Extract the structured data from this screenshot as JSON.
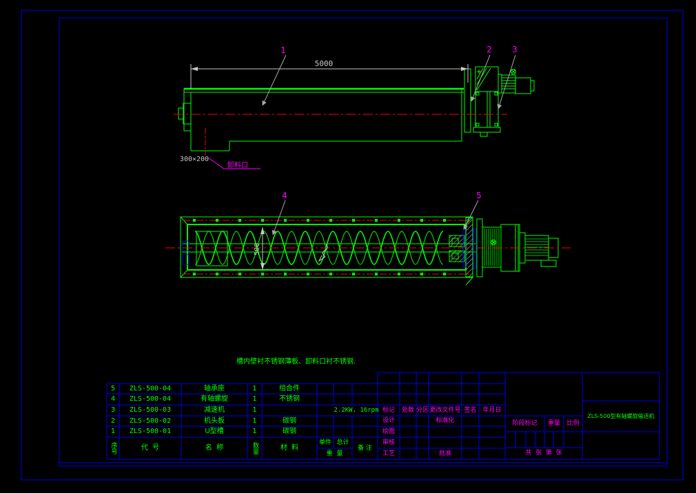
{
  "note": "槽内壁衬不锈钢薄板、卸料口衬不锈钢.",
  "top_view": {
    "dim_length": "5000",
    "chute_dim": "300×200",
    "chute_label": "卸料口",
    "balloon_1": "1",
    "balloon_2": "2",
    "balloon_3": "3"
  },
  "bottom_view": {
    "dim_width": "500",
    "balloon_4": "4",
    "balloon_5": "5"
  },
  "colors": {
    "line_green": "#00ff00",
    "line_red": "#ff0000",
    "line_blue": "#0000ee",
    "label_magenta": "#ff00ff",
    "dim_white": "#c8c8c8"
  },
  "parts_table": {
    "headers": {
      "seq": "序号",
      "code": "代  号",
      "name": "名  称",
      "qty": "数量",
      "material": "材  料",
      "unit_piece": "单件",
      "total": "总计",
      "weight": "重  量",
      "remark": "备 注"
    },
    "rows": [
      {
        "seq": "5",
        "code": "ZLS-500-04",
        "name": "轴承座",
        "qty": "1",
        "material": "组合件"
      },
      {
        "seq": "4",
        "code": "ZLS-500-04",
        "name": "有轴螺旋",
        "qty": "1",
        "material": "不锈钢"
      },
      {
        "seq": "3",
        "code": "ZLS-500-03",
        "name": "减速机",
        "qty": "1",
        "material": "",
        "remark": "2.2KW, 16rpm"
      },
      {
        "seq": "2",
        "code": "ZLS-500-02",
        "name": "机头板",
        "qty": "1",
        "material": "碳钢"
      },
      {
        "seq": "1",
        "code": "ZLS-500-01",
        "name": "U型槽",
        "qty": "1",
        "material": "碳钢"
      }
    ]
  },
  "title_block": {
    "col_mark": "标记",
    "col_count": "处数",
    "col_zone": "分区",
    "col_change_doc": "更改文件号",
    "col_sign": "签名",
    "col_date": "年月日",
    "row_design": "设计",
    "row_draw": "绘图",
    "row_check": "审核",
    "row_process": "工艺",
    "standardization": "标准化",
    "approve": "批准",
    "stage_mark": "阶段标记",
    "weight": "重量",
    "scale": "比例",
    "sheet_info": "共  张  第  张",
    "drawing_title": "ZLS-500型有轴螺旋输送机"
  }
}
